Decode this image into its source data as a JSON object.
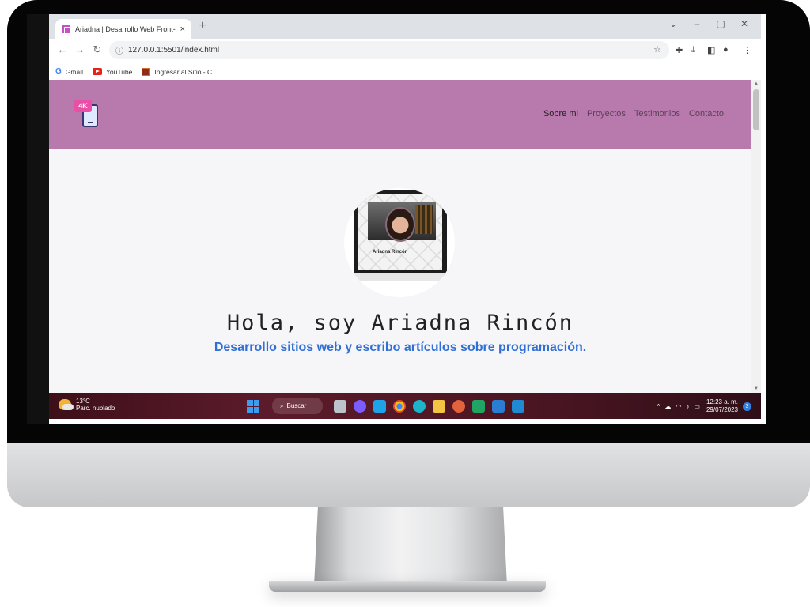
{
  "browser": {
    "tab_title": "Ariadna | Desarrollo Web Front-E",
    "tab_close": "×",
    "new_tab": "+",
    "url": "127.0.0.1:5501/index.html",
    "bookmarks": [
      "Gmail",
      "YouTube",
      "Ingresar al Sitio - C..."
    ]
  },
  "site": {
    "logo_badge": "4K",
    "nav": [
      "Sobre mi",
      "Proyectos",
      "Testimonios",
      "Contacto"
    ],
    "active_nav": "Sobre mi",
    "profile_name_on_laptop": "Ariadna Rincón",
    "hero_title": "Hola, soy Ariadna Rincón",
    "hero_subtitle": "Desarrollo sitios web y escribo artículos sobre programación."
  },
  "taskbar": {
    "temperature": "13°C",
    "weather": "Parc. nublado",
    "search_label": "Buscar",
    "time": "12:23 a. m.",
    "date": "29/07/2023",
    "notifications": "3"
  },
  "colors": {
    "navbar_bg": "#b87aad",
    "subtitle": "#2f6fd6",
    "logo_badge": "#ea4ea6"
  }
}
